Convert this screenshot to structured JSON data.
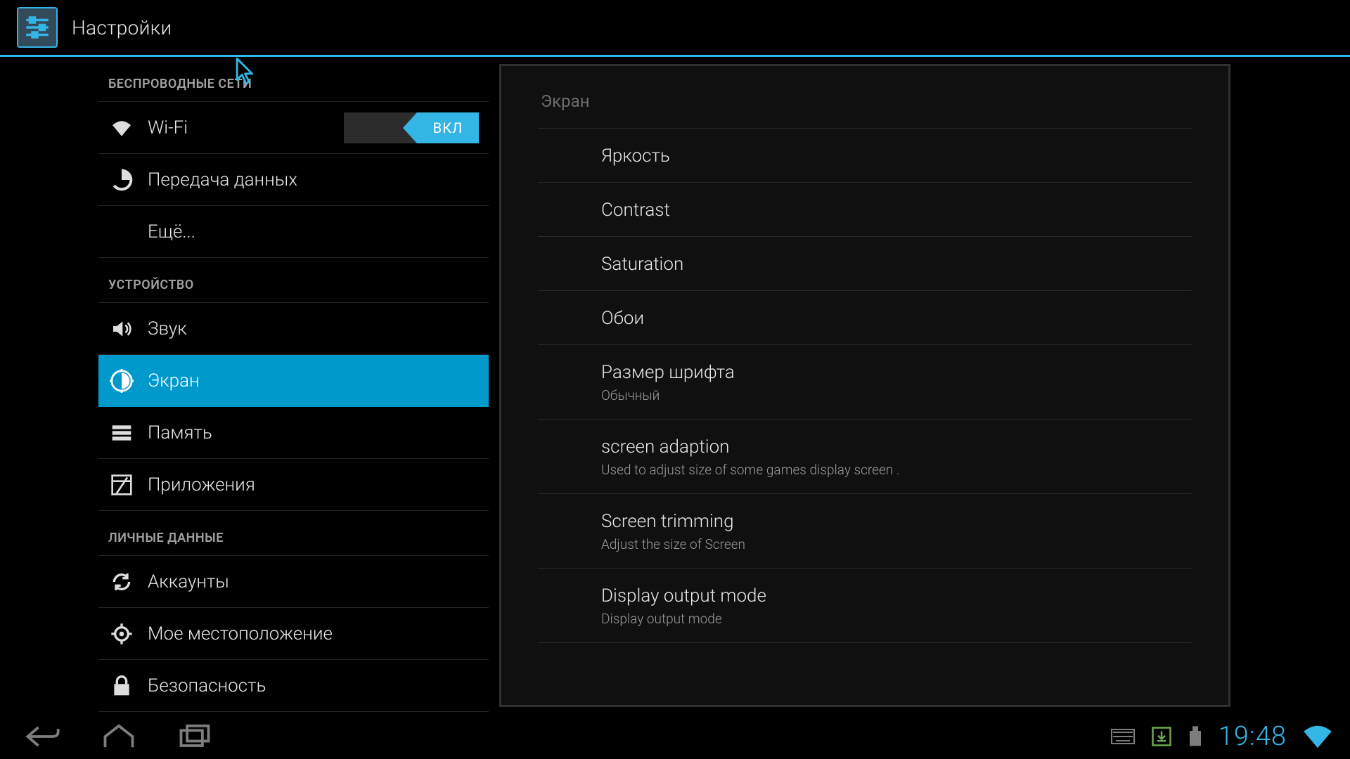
{
  "header": {
    "title": "Настройки"
  },
  "sidebar": {
    "sections": [
      {
        "header": "БЕСПРОВОДНЫЕ СЕТИ",
        "items": [
          {
            "id": "wifi",
            "label": "Wi-Fi",
            "icon": "wifi-icon",
            "toggle": {
              "on": true,
              "on_label": "ВКЛ"
            }
          },
          {
            "id": "data-usage",
            "label": "Передача данных",
            "icon": "data-usage-icon"
          },
          {
            "id": "more",
            "label": "Ещё...",
            "icon": ""
          }
        ]
      },
      {
        "header": "УСТРОЙСТВО",
        "items": [
          {
            "id": "sound",
            "label": "Звук",
            "icon": "volume-icon"
          },
          {
            "id": "display",
            "label": "Экран",
            "icon": "brightness-icon",
            "selected": true
          },
          {
            "id": "storage",
            "label": "Память",
            "icon": "storage-icon"
          },
          {
            "id": "apps",
            "label": "Приложения",
            "icon": "apps-icon"
          }
        ]
      },
      {
        "header": "ЛИЧНЫЕ ДАННЫЕ",
        "items": [
          {
            "id": "accounts",
            "label": "Аккаунты",
            "icon": "sync-icon"
          },
          {
            "id": "location",
            "label": "Мое местоположение",
            "icon": "location-icon"
          },
          {
            "id": "security",
            "label": "Безопасность",
            "icon": "lock-icon"
          }
        ]
      }
    ]
  },
  "panel": {
    "title": "Экран",
    "items": [
      {
        "id": "brightness",
        "title": "Яркость"
      },
      {
        "id": "contrast",
        "title": "Contrast"
      },
      {
        "id": "saturation",
        "title": "Saturation"
      },
      {
        "id": "wallpaper",
        "title": "Обои"
      },
      {
        "id": "font-size",
        "title": "Размер шрифта",
        "sub": "Обычный"
      },
      {
        "id": "screen-adaption",
        "title": "screen adaption",
        "sub": "Used to adjust size of some games display screen ."
      },
      {
        "id": "screen-trimming",
        "title": "Screen trimming",
        "sub": "Adjust the size of Screen"
      },
      {
        "id": "display-output-mode",
        "title": "Display output mode",
        "sub": "Display output mode"
      }
    ]
  },
  "statusbar": {
    "clock": "19:48"
  }
}
